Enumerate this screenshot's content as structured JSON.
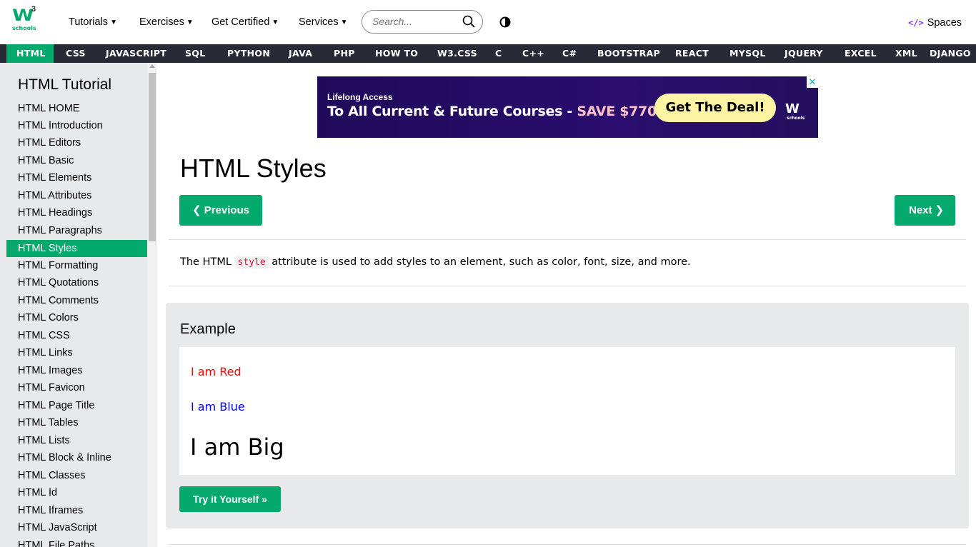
{
  "header": {
    "logo_text": "W",
    "logo_sup": "3",
    "logo_sub": "schools",
    "menu": [
      "Tutorials",
      "Exercises",
      "Get Certified",
      "Services"
    ],
    "search_placeholder": "Search...",
    "spaces_label": "Spaces",
    "spaces_code": "</>"
  },
  "navbar": {
    "items": [
      "HTML",
      "CSS",
      "JAVASCRIPT",
      "SQL",
      "PYTHON",
      "JAVA",
      "PHP",
      "HOW TO",
      "W3.CSS",
      "C",
      "C++",
      "C#",
      "BOOTSTRAP",
      "REACT",
      "MYSQL",
      "JQUERY",
      "EXCEL",
      "XML",
      "DJANGO"
    ],
    "active_index": 0
  },
  "sidebar": {
    "title": "HTML Tutorial",
    "items": [
      "HTML HOME",
      "HTML Introduction",
      "HTML Editors",
      "HTML Basic",
      "HTML Elements",
      "HTML Attributes",
      "HTML Headings",
      "HTML Paragraphs",
      "HTML Styles",
      "HTML Formatting",
      "HTML Quotations",
      "HTML Comments",
      "HTML Colors",
      "HTML CSS",
      "HTML Links",
      "HTML Images",
      "HTML Favicon",
      "HTML Page Title",
      "HTML Tables",
      "HTML Lists",
      "HTML Block & Inline",
      "HTML Classes",
      "HTML Id",
      "HTML Iframes",
      "HTML JavaScript",
      "HTML File Paths"
    ],
    "active_index": 8
  },
  "ad": {
    "small": "Lifelong Access",
    "big": "To All Current & Future Courses - ",
    "save": "SAVE $770",
    "deal": "Get The Deal!",
    "logo": "W",
    "logo_sub": "schools",
    "close": "✕"
  },
  "main": {
    "title": "HTML Styles",
    "prev": "❮ Previous",
    "next": "Next ❯",
    "intro_before": "The HTML ",
    "intro_code": "style",
    "intro_after": " attribute is used to add styles to an element, such as color, font, size, and more."
  },
  "example": {
    "heading": "Example",
    "red_text": "I am Red",
    "blue_text": "I am Blue",
    "big_text": "I am Big",
    "try_label": "Try it Yourself »"
  },
  "colors": {
    "brand_green": "#04AA6D",
    "nav_dark": "#282A35",
    "sidebar_bg": "#E7E9EB"
  }
}
